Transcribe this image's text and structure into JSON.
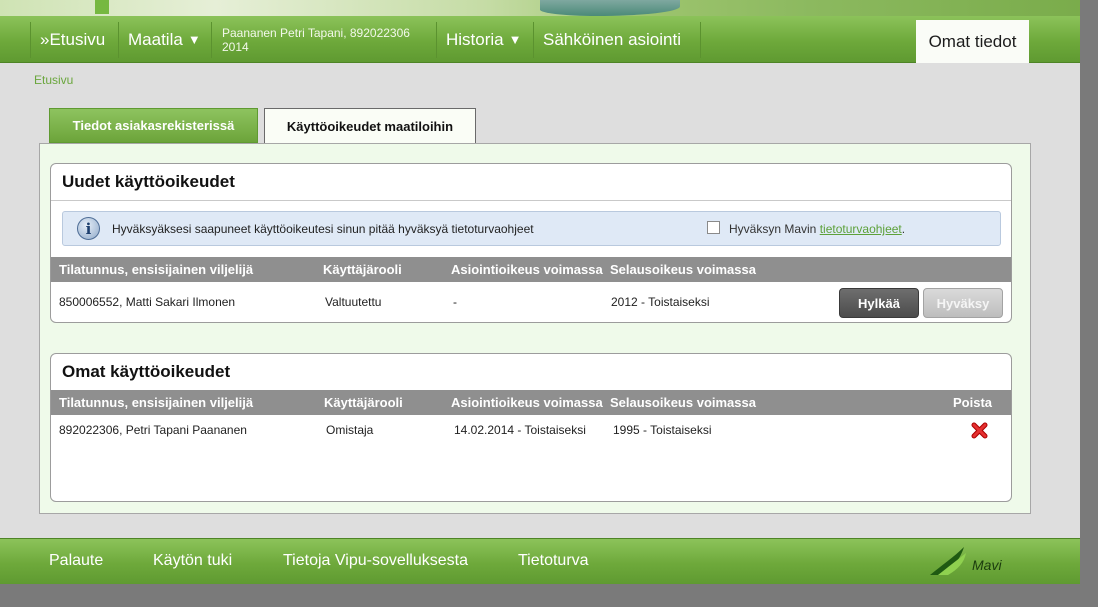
{
  "nav": {
    "etusivu": "»Etusivu",
    "maatila": "Maatila",
    "user_line1": "Paananen Petri Tapani, 892022306",
    "user_line2": "2014",
    "historia": "Historia",
    "sahkoinen": "Sähköinen asiointi",
    "omat": "Omat tiedot",
    "caret": "▼"
  },
  "breadcrumb": "Etusivu",
  "tabs": [
    "Tiedot asiakasrekisterissä",
    "Käyttöoikeudet maatiloihin"
  ],
  "new_rights": {
    "title": "Uudet käyttöoikeudet",
    "info_text": "Hyväksyäksesi saapuneet käyttöoikeutesi sinun pitää hyväksyä tietoturvaohjeet",
    "accept_prefix": "Hyväksyn Mavin ",
    "accept_link": "tietoturvaohjeet",
    "accept_suffix": ".",
    "columns": [
      "Tilatunnus, ensisijainen viljelijä",
      "Käyttäjärooli",
      "Asiointioikeus voimassa",
      "Selausoikeus voimassa"
    ],
    "row": [
      "850006552, Matti Sakari Ilmonen",
      "Valtuutettu",
      "-",
      "2012 - Toistaiseksi"
    ],
    "reject_label": "Hylkää",
    "accept_label": "Hyväksy"
  },
  "own_rights": {
    "title": "Omat käyttöoikeudet",
    "columns": [
      "Tilatunnus, ensisijainen viljelijä",
      "Käyttäjärooli",
      "Asiointioikeus voimassa",
      "Selausoikeus voimassa",
      "Poista"
    ],
    "row": [
      "892022306, Petri Tapani Paananen",
      "Omistaja",
      "14.02.2014 - Toistaiseksi",
      "1995 - Toistaiseksi"
    ]
  },
  "footer": {
    "links": [
      "Palaute",
      "Käytön tuki",
      "Tietoja Vipu-sovelluksesta",
      "Tietoturva"
    ],
    "logo_text": "Mavi"
  },
  "colors": {
    "green": "#6ea93b",
    "header_gray": "#8f8f8f",
    "delete_red": "#d42020"
  },
  "icons": {
    "info": "info-icon",
    "delete": "delete-x-icon",
    "logo": "mavi-logo"
  }
}
